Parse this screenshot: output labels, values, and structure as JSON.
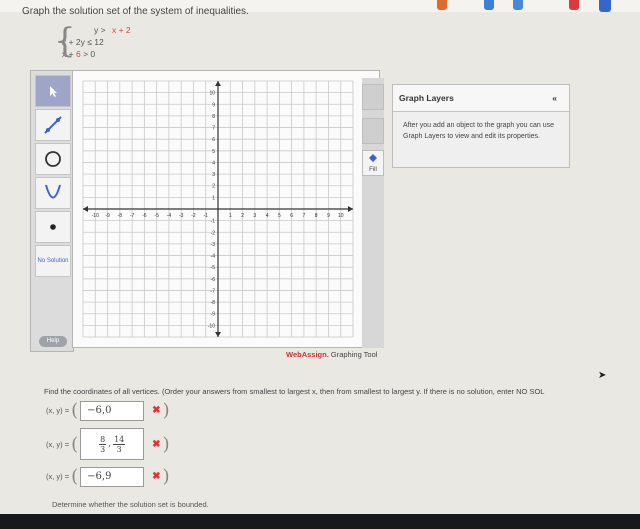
{
  "prompt": "Graph the solution set of the system of inequalities.",
  "system": {
    "line1": {
      "lhs": "y >",
      "rhs": "x + 2"
    },
    "line2": "x + 2y ≤ 12",
    "line3": {
      "a": "x +",
      "b": "6",
      "c": "> 0"
    }
  },
  "tools": [
    {
      "name": "pointer-tool-icon"
    },
    {
      "name": "line-tool-icon"
    },
    {
      "name": "circle-tool-icon"
    },
    {
      "name": "parabola-tool-icon"
    },
    {
      "name": "point-tool-icon"
    },
    {
      "name": "no-solution-button",
      "label": "No Solution"
    }
  ],
  "help_label": "Help",
  "graph": {
    "xlim": [
      -11,
      11
    ],
    "ylim": [
      -11,
      11
    ],
    "x_ticks": [
      "-10",
      "-9",
      "-8",
      "-7",
      "-6",
      "-5",
      "-4",
      "-3",
      "-2",
      "-1",
      "1",
      "2",
      "3",
      "4",
      "5",
      "6",
      "7",
      "8",
      "9",
      "10"
    ],
    "y_ticks": [
      "10",
      "9",
      "8",
      "7",
      "6",
      "5",
      "4",
      "3",
      "2",
      "1",
      "-1",
      "-2",
      "-3",
      "-4",
      "-5",
      "-6",
      "-7",
      "-8",
      "-9",
      "-10"
    ]
  },
  "right_tools": {
    "fill_label": "Fill"
  },
  "brand": {
    "web": "WebAssign.",
    "suffix": " Graphing Tool"
  },
  "graph_layers": {
    "title": "Graph Layers",
    "collapse": "«",
    "body": "After you add an object to the graph you can use Graph Layers to view and edit its properties."
  },
  "question": "Find the coordinates of all vertices. (Order your answers from smallest to largest x, then from smallest to largest y. If there is no solution, enter NO SOL",
  "answers": [
    {
      "label": "(x, y) =",
      "value": "−6,0",
      "mark": "✖"
    },
    {
      "label": "(x, y) =",
      "num1": "8",
      "den1": "3",
      "sep": ",",
      "num2": "14",
      "den2": "3",
      "mark": "✖"
    },
    {
      "label": "(x, y) =",
      "value": "−6,9",
      "mark": "✖"
    }
  ],
  "bounded_prompt": "Determine whether the solution set is bounded.",
  "colors": {
    "accent_red": "#d33333",
    "panel": "#dcdcdc"
  }
}
